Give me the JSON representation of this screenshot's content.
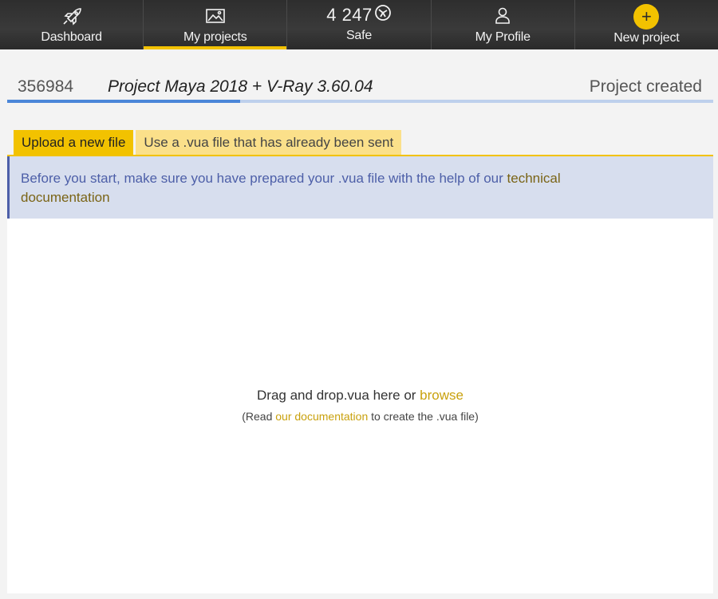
{
  "nav": {
    "dashboard_label": "Dashboard",
    "projects_label": "My projects",
    "safe_count": "4 247",
    "safe_label": "Safe",
    "profile_label": "My Profile",
    "new_project_icon": "+",
    "new_project_label": "New project",
    "accent_color": "#f2c200"
  },
  "project": {
    "id": "356984",
    "name": "Project Maya 2018 + V-Ray 3.60.04",
    "status": "Project created",
    "progress_fraction": 0.33
  },
  "tabs": [
    {
      "label": "Upload a new file",
      "active": true
    },
    {
      "label": "Use a .vua file that has already been sent",
      "active": false
    }
  ],
  "info": {
    "text": "Before you start, make sure you have prepared your .vua file with the help of our ",
    "link_line1": "technical",
    "link_line2": "documentation"
  },
  "dropzone": {
    "main_text": "Drag and drop.vua here or ",
    "browse_link": "browse",
    "sub_prefix": "(Read ",
    "sub_link": "our documentation",
    "sub_suffix": " to create the .vua file)"
  },
  "icons": {
    "dashboard": "rocket-icon",
    "projects": "image-icon",
    "safe": "coin-icon",
    "profile": "user-icon",
    "new_project": "plus-icon"
  }
}
